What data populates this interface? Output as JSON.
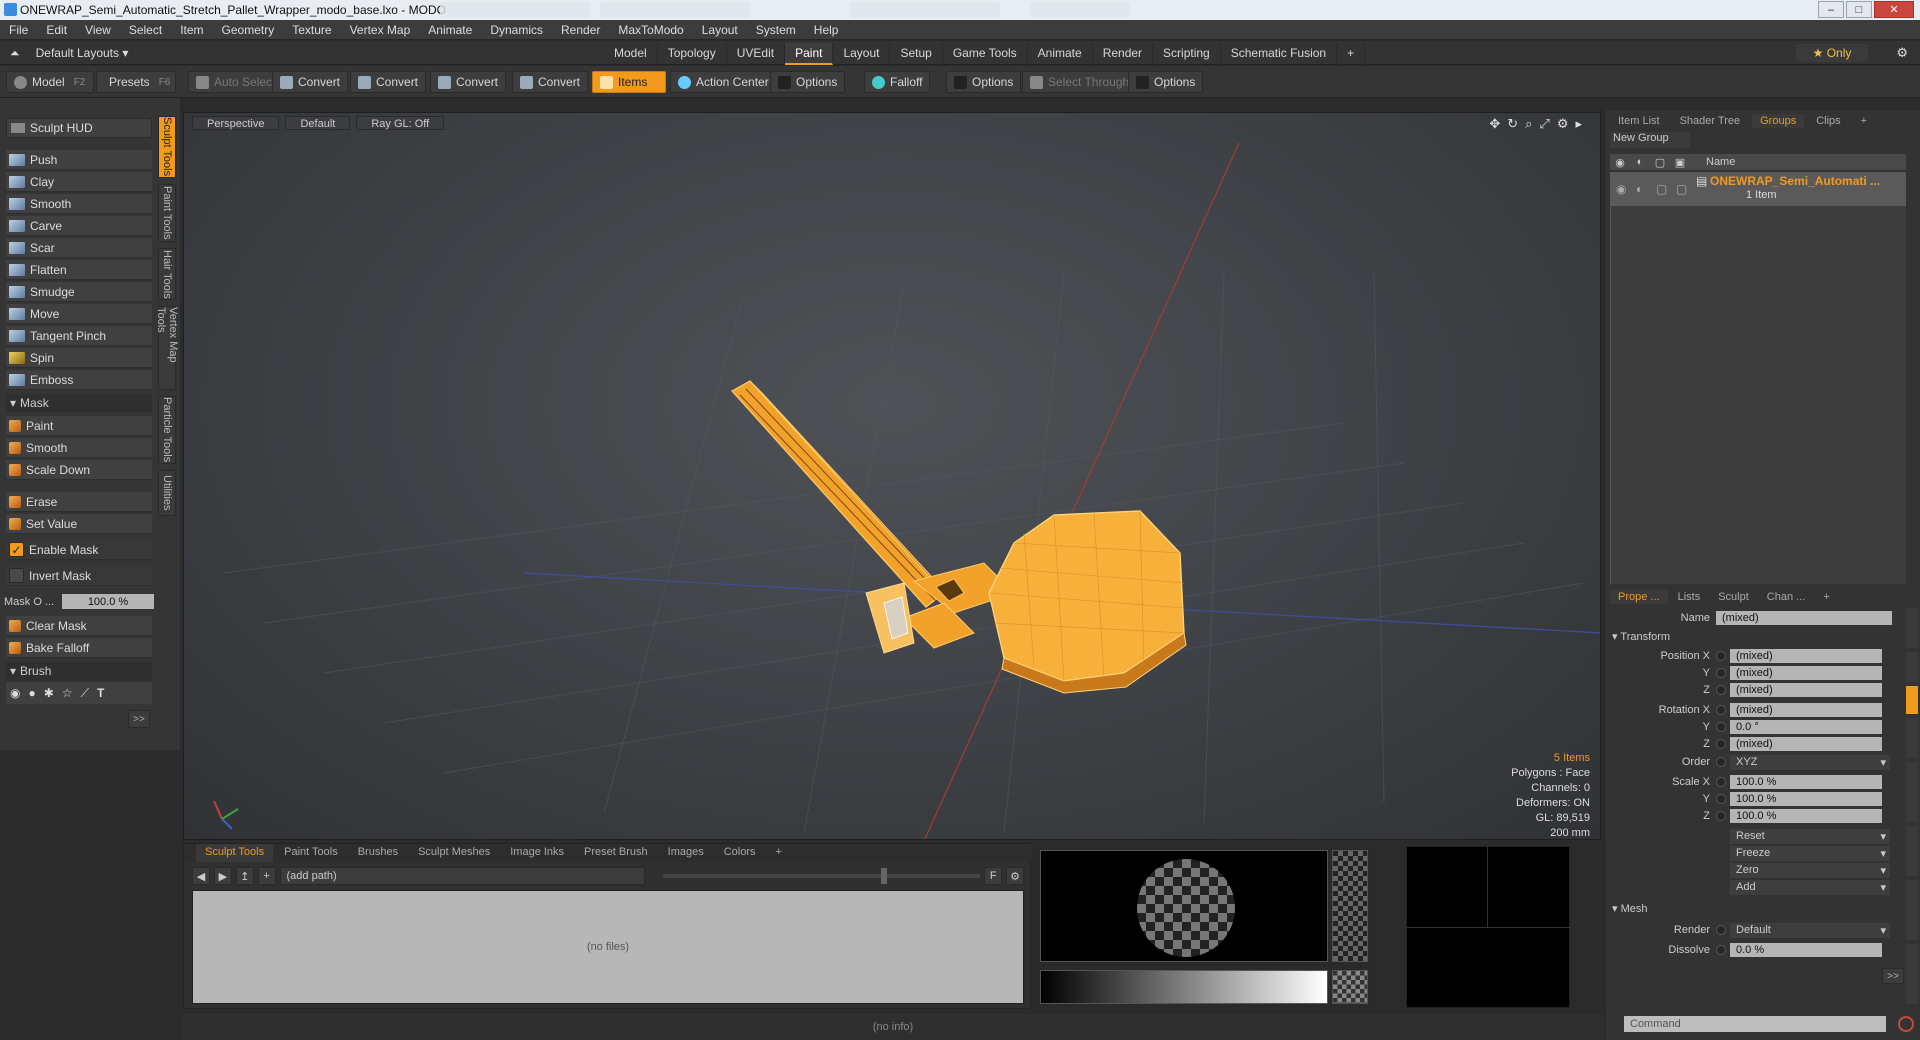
{
  "window": {
    "title": "ONEWRAP_Semi_Automatic_Stretch_Pallet_Wrapper_modo_base.lxo - MODO",
    "minimize": "–",
    "maximize": "□",
    "close": "✕"
  },
  "menu": [
    "File",
    "Edit",
    "View",
    "Select",
    "Item",
    "Geometry",
    "Texture",
    "Vertex Map",
    "Animate",
    "Dynamics",
    "Render",
    "MaxToModo",
    "Layout",
    "System",
    "Help"
  ],
  "layouts": {
    "label": "Default Layouts ▾",
    "only": "★ Only"
  },
  "layout_tabs": [
    "Model",
    "Topology",
    "UVEdit",
    "Paint",
    "Layout",
    "Setup",
    "Game Tools",
    "Animate",
    "Render",
    "Scripting",
    "Schematic Fusion",
    "+"
  ],
  "active_layout_tab": "Paint",
  "toolbar": {
    "model": "Model",
    "model_key": "F2",
    "presets": "Presets",
    "presets_key": "F6",
    "auto_select": "Auto Select",
    "convert1": "Convert",
    "convert2": "Convert",
    "convert3": "Convert",
    "convert4": "Convert",
    "items": "Items",
    "action_center": "Action Center",
    "options1": "Options",
    "falloff": "Falloff",
    "options2": "Options",
    "select_through": "Select Through",
    "options3": "Options"
  },
  "left": {
    "hud": "Sculpt HUD",
    "tools": [
      "Push",
      "Clay",
      "Smooth",
      "Carve",
      "Scar",
      "Flatten",
      "Smudge",
      "Move",
      "Tangent Pinch",
      "Spin",
      "Emboss"
    ],
    "mask_header": "Mask",
    "mask_tools": [
      "Paint",
      "Smooth",
      "Scale Down"
    ],
    "erase": "Erase",
    "set_value": "Set Value",
    "enable_mask": "Enable Mask",
    "invert_mask": "Invert Mask",
    "mask_opacity_label": "Mask O ...",
    "mask_opacity_value": "100.0 %",
    "clear_mask": "Clear Mask",
    "bake_falloff": "Bake Falloff",
    "brush_header": "Brush",
    "more": ">>"
  },
  "vertical_tabs": [
    "Sculpt Tools",
    "Paint Tools",
    "Hair Tools",
    "Vertex Map Tools",
    "Particle Tools",
    "Utilities"
  ],
  "viewport": {
    "perspective": "Perspective",
    "default": "Default",
    "raygl": "Ray GL: Off",
    "stats": {
      "items": "5 Items",
      "polygons": "Polygons : Face",
      "channels": "Channels: 0",
      "deformers": "Deformers: ON",
      "gl": "GL: 89,519",
      "scale": "200 mm"
    }
  },
  "bottom": {
    "tabs": [
      "Sculpt Tools",
      "Paint Tools",
      "Brushes",
      "Sculpt Meshes",
      "Image Inks",
      "Preset Brush",
      "Images",
      "Colors",
      "+"
    ],
    "path": "(add path)",
    "no_files": "(no files)",
    "f_btn": "F"
  },
  "status": "(no info)",
  "right": {
    "tabs": [
      "Item List",
      "Shader Tree",
      "Groups",
      "Clips",
      "+"
    ],
    "active_tab": "Groups",
    "new_group": "New Group",
    "name_col": "Name",
    "group_name": "ONEWRAP_Semi_Automati ...",
    "group_sub": "1 Item",
    "prop_tabs": [
      "Prope ...",
      "Lists",
      "Sculpt",
      "Chan ...",
      "+"
    ],
    "name_label": "Name",
    "name_value": "(mixed)",
    "transform": "Transform",
    "pos_x": "Position X",
    "pos_x_v": "(mixed)",
    "pos_y": "Y",
    "pos_y_v": "(mixed)",
    "pos_z": "Z",
    "pos_z_v": "(mixed)",
    "rot_x": "Rotation X",
    "rot_x_v": "(mixed)",
    "rot_y": "Y",
    "rot_y_v": "0.0 °",
    "rot_z": "Z",
    "rot_z_v": "(mixed)",
    "order": "Order",
    "order_v": "XYZ",
    "scale_x": "Scale X",
    "scale_x_v": "100.0 %",
    "scale_y": "Y",
    "scale_y_v": "100.0 %",
    "scale_z": "Z",
    "scale_z_v": "100.0 %",
    "reset": "Reset",
    "freeze": "Freeze",
    "zero": "Zero",
    "add": "Add",
    "mesh": "Mesh",
    "render": "Render",
    "render_v": "Default",
    "dissolve": "Dissolve",
    "dissolve_v": "0.0 %",
    "more": ">>",
    "command": "Command"
  },
  "colors": {
    "accent": "#f29a1c",
    "bg": "#2b2b2b"
  }
}
